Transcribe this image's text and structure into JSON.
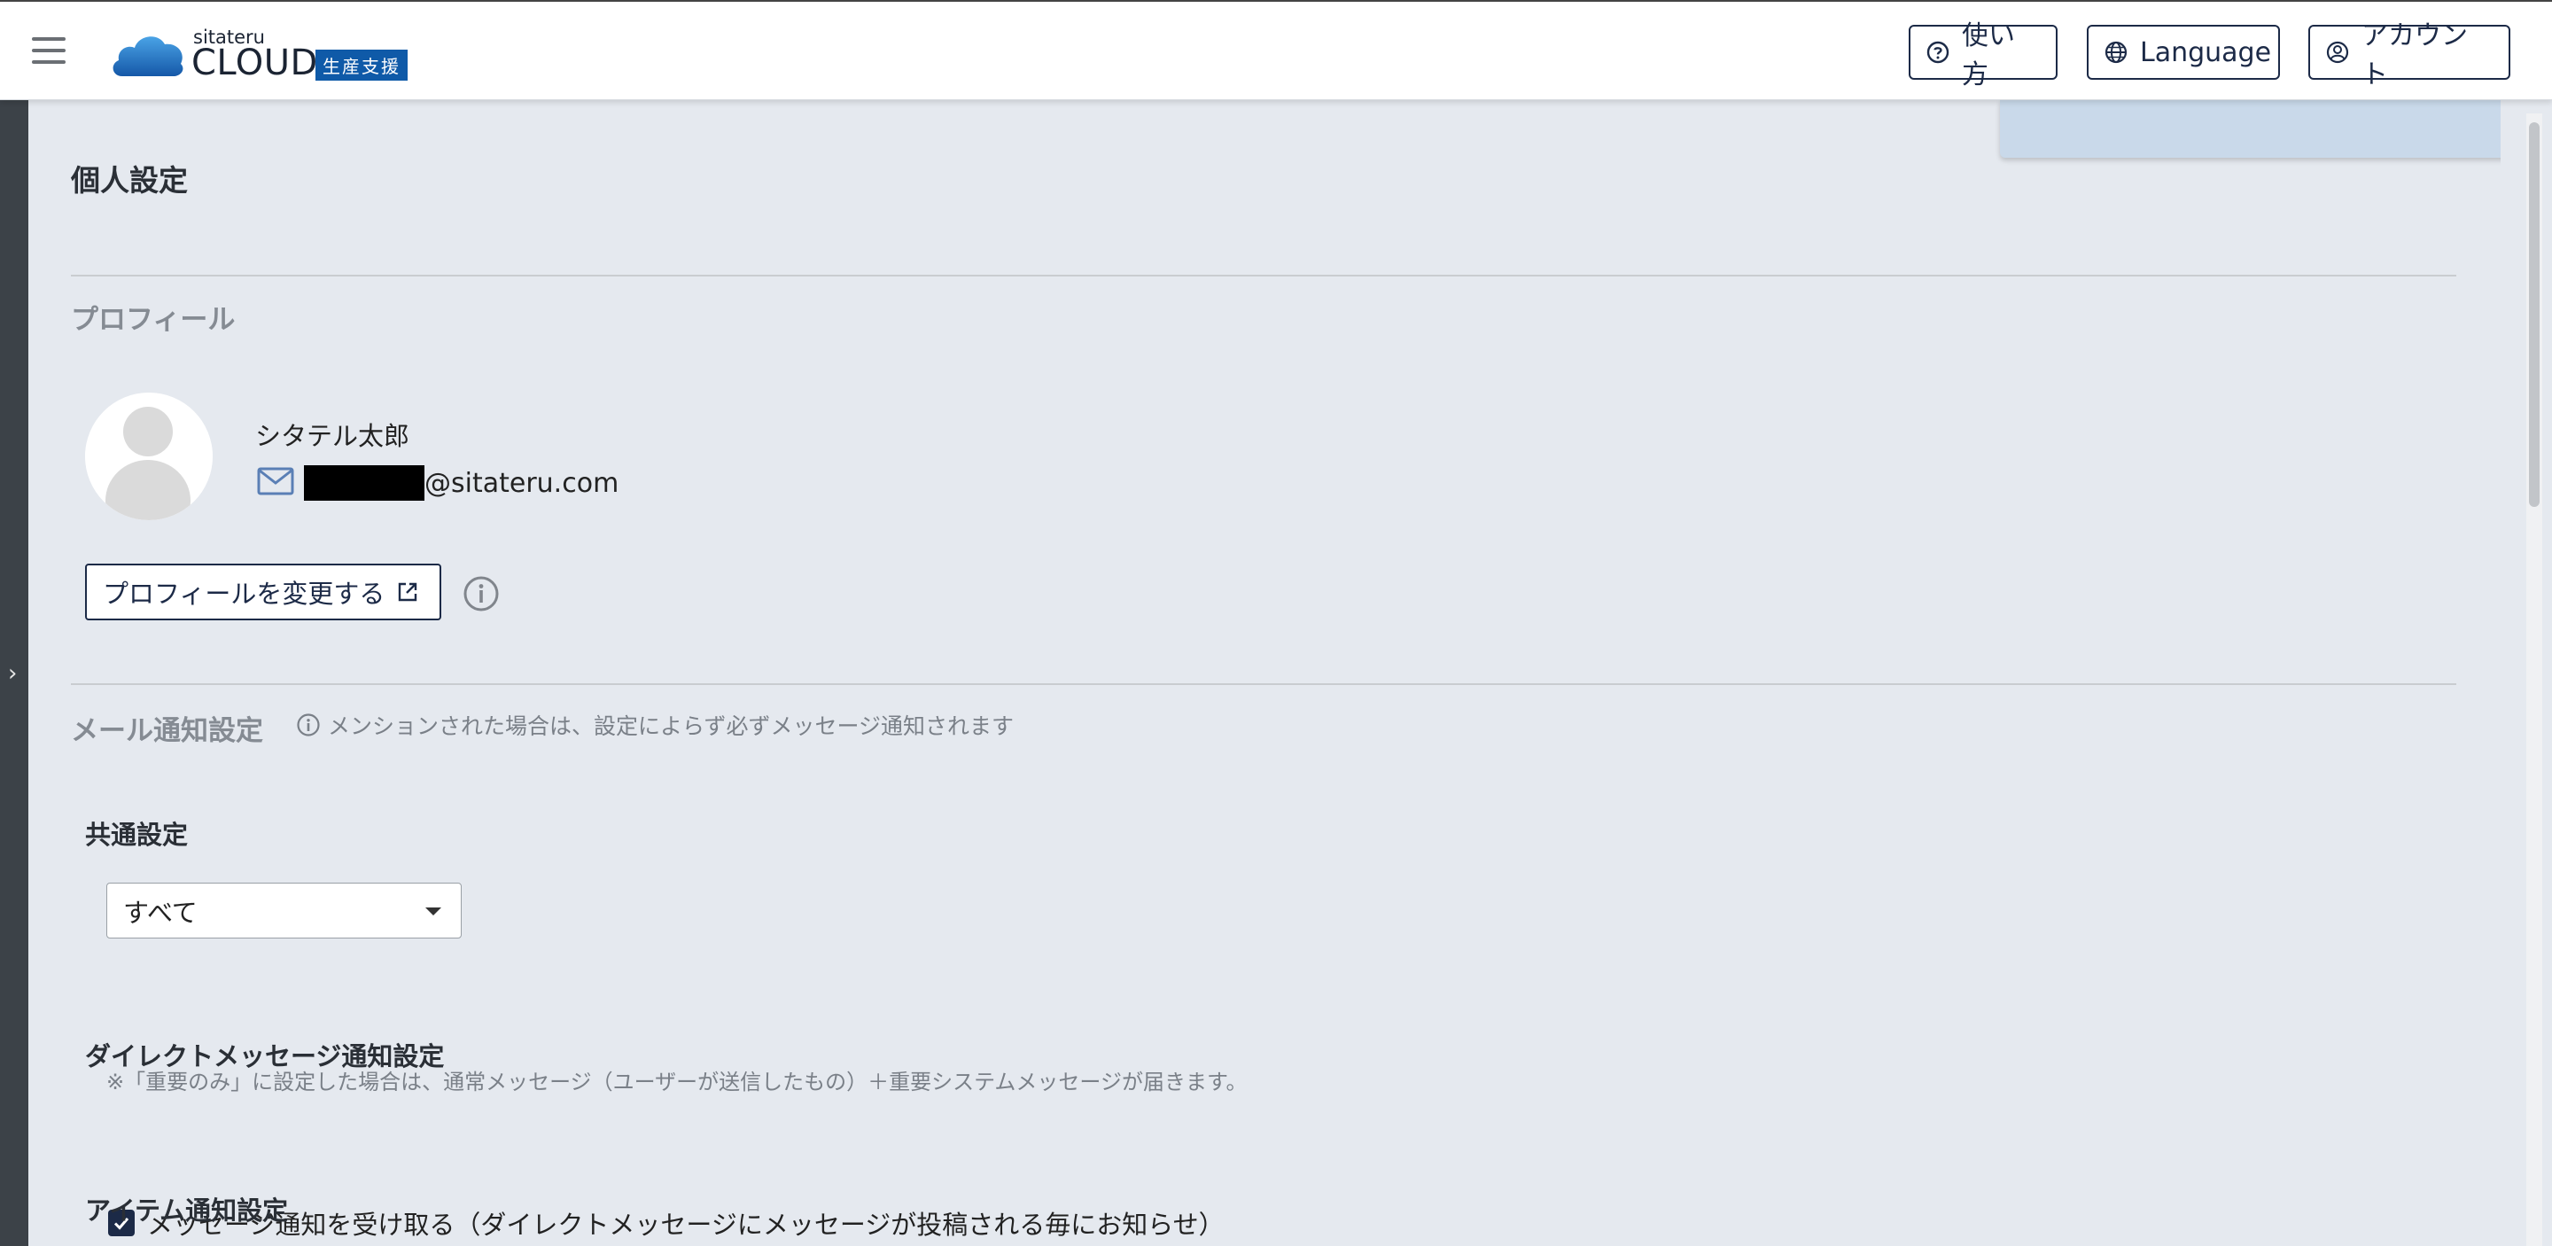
{
  "header": {
    "logo_small": "sitateru",
    "logo_big": "CLOUD",
    "logo_badge": "生産支援",
    "help_label": "使い方",
    "language_label": "Language",
    "account_label": "アカウント"
  },
  "page": {
    "title": "個人設定"
  },
  "profile": {
    "section_title": "プロフィール",
    "name": "シタテル太郎",
    "email_domain": "@sitateru.com",
    "change_button": "プロフィールを変更する"
  },
  "mail": {
    "section_title": "メール通知設定",
    "note": "メンションされた場合は、設定によらず必ずメッセージ通知されます",
    "common_title": "共通設定",
    "select_value": "すべて",
    "select_note": "※「重要のみ」に設定した場合は、通常メッセージ（ユーザーが送信したもの）＋重要システムメッセージが届きます。",
    "dm_title": "ダイレクトメッセージ通知設定",
    "dm_checkbox_label": "メッセージ通知を受け取る（ダイレクトメッセージにメッセージが投稿される毎にお知らせ）",
    "dm_checked": true,
    "item_title": "アイテム通知設定"
  },
  "colors": {
    "accent": "#1c2a47",
    "badge": "#0f5aa8",
    "background": "#e5e9ef"
  }
}
